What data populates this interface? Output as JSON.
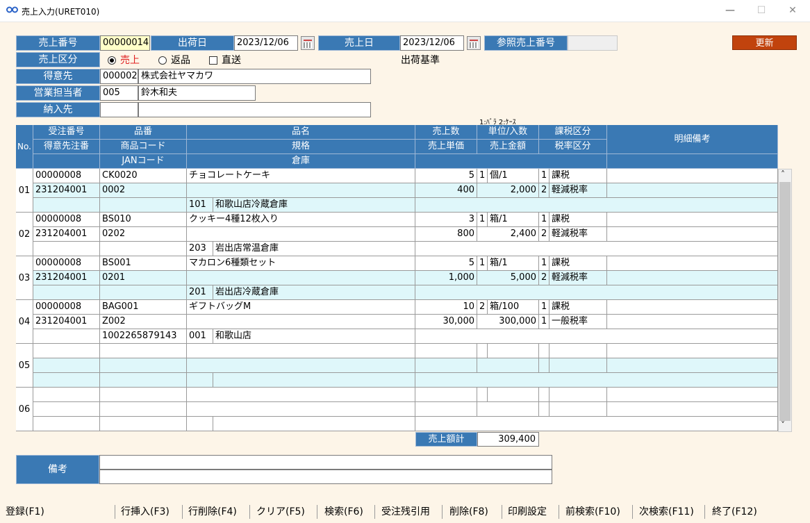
{
  "window": {
    "title": "売上入力(URET010)",
    "minimize": "—",
    "maximize": "☐",
    "close": "✕"
  },
  "header": {
    "uriage_bango_label": "売上番号",
    "uriage_bango": "00000014",
    "shukka_bi_label": "出荷日",
    "shukka_bi": "2023/12/06",
    "uriage_bi_label": "売上日",
    "uriage_bi": "2023/12/06",
    "sansho_label": "参照売上番号",
    "sansho": "",
    "update_button": "更新",
    "kubun_label": "売上区分",
    "kubun_options": [
      "売上",
      "返品",
      "直送"
    ],
    "kubun_selected": "売上",
    "shukka_kijun": "出荷基準",
    "tokuisaki_label": "得意先",
    "tokuisaki_code": "000002",
    "tokuisaki_name": "株式会社ヤマカワ",
    "tanto_label": "営業担当者",
    "tanto_code": "005",
    "tanto_name": "鈴木和夫",
    "nonyusaki_label": "納入先",
    "nonyusaki_code": "",
    "nonyusaki_name": ""
  },
  "grid": {
    "unit_hint": "1:ﾊﾞﾗ 2:ｹｰｽ",
    "headers": {
      "no": "No.",
      "juchu": "受注番号",
      "tokuisaki_chuban": "得意先注番",
      "hinban": "品番",
      "shohin_code": "商品コード",
      "jan": "JANコード",
      "hinmei": "品名",
      "kikaku": "規格",
      "soko": "倉庫",
      "suryo": "売上数",
      "tanka": "売上単価",
      "tani": "単位/入数",
      "kingaku": "売上金額",
      "kazei": "課税区分",
      "zeiritsu": "税率区分",
      "biko": "明細備考"
    },
    "rows": [
      {
        "no": "01",
        "juchu": "00000008",
        "chuban": "231204001",
        "hinban": "CK0020",
        "shohin": "0002",
        "jan": "",
        "hinmei": "チョコレートケーキ",
        "soko_code": "101",
        "soko_name": "和歌山店冷蔵倉庫",
        "suryo": "5",
        "tani_kbn": "1",
        "tani": "個/1",
        "tanka": "400",
        "kingaku": "2,000",
        "kazei_kbn": "1",
        "kazei": "課税",
        "zei_kbn": "2",
        "zei": "軽減税率"
      },
      {
        "no": "02",
        "juchu": "00000008",
        "chuban": "231204001",
        "hinban": "BS010",
        "shohin": "0202",
        "jan": "",
        "hinmei": "クッキー4種12枚入り",
        "soko_code": "203",
        "soko_name": "岩出店常温倉庫",
        "suryo": "3",
        "tani_kbn": "1",
        "tani": "箱/1",
        "tanka": "800",
        "kingaku": "2,400",
        "kazei_kbn": "1",
        "kazei": "課税",
        "zei_kbn": "2",
        "zei": "軽減税率"
      },
      {
        "no": "03",
        "juchu": "00000008",
        "chuban": "231204001",
        "hinban": "BS001",
        "shohin": "0201",
        "jan": "",
        "hinmei": "マカロン6種類セット",
        "soko_code": "201",
        "soko_name": "岩出店冷蔵倉庫",
        "suryo": "5",
        "tani_kbn": "1",
        "tani": "箱/1",
        "tanka": "1,000",
        "kingaku": "5,000",
        "kazei_kbn": "1",
        "kazei": "課税",
        "zei_kbn": "2",
        "zei": "軽減税率"
      },
      {
        "no": "04",
        "juchu": "00000008",
        "chuban": "231204001",
        "hinban": "BAG001",
        "shohin": "Z002",
        "jan": "1002265879143",
        "hinmei": "ギフトバッグM",
        "soko_code": "001",
        "soko_name": "和歌山店",
        "suryo": "10",
        "tani_kbn": "2",
        "tani": "箱/100",
        "tanka": "30,000",
        "kingaku": "300,000",
        "kazei_kbn": "1",
        "kazei": "課税",
        "zei_kbn": "1",
        "zei": "一般税率"
      },
      {
        "no": "05"
      },
      {
        "no": "06"
      }
    ],
    "total_label": "売上額計",
    "total": "309,400",
    "scroll_up": "˄",
    "scroll_down": "˅"
  },
  "biko_label": "備考",
  "fkeys": [
    "登録(F1)",
    "行挿入(F3)",
    "行削除(F4)",
    "クリア(F5)",
    "検索(F6)",
    "受注残引用",
    "削除(F8)",
    "印刷設定",
    "前検索(F10)",
    "次検索(F11)",
    "終了(F12)"
  ]
}
